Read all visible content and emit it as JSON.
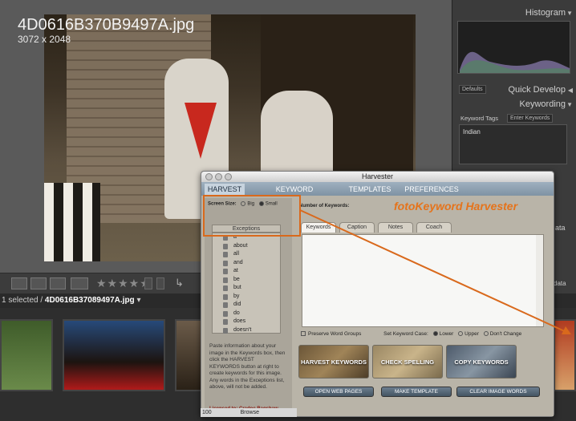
{
  "photo": {
    "filename": "4D0616B370B9497A.jpg",
    "dimensions": "3072 x 2048"
  },
  "toolbar": {
    "stars": "★★★★★"
  },
  "pathbar": {
    "selected_prefix": "1 selected / ",
    "selected_file": "4D0616B37089497A.jpg",
    "caret": "▾"
  },
  "right_panel": {
    "histogram_title": "Histogram",
    "defaults_label": "Defaults",
    "quick_develop_title": "Quick Develop",
    "keywording_title": "Keywording",
    "keyword_tags_label": "Keyword Tags",
    "keyword_tags_select": "Enter Keywords",
    "keyword_value": "Indian",
    "metadata_partial": "ata",
    "metadata_partial2": "data"
  },
  "harvester": {
    "title": "Harvester",
    "tabs": [
      "HARVEST",
      "KEYWORD COMPOSER",
      "TEMPLATES",
      "PREFERENCES"
    ],
    "screen_size_label": "Screen Size:",
    "screen_size_big": "Big",
    "screen_size_small": "Small",
    "number_of_keywords_label": "Number of Keywords:",
    "brand": "fotoKeyword Harvester",
    "exceptions_header": "Exceptions",
    "exceptions": [
      "a",
      "about",
      "all",
      "and",
      "at",
      "be",
      "but",
      "by",
      "did",
      "do",
      "does",
      "doesn't"
    ],
    "paste_info": "Paste information about your image in the Keywords box, then click the HARVEST KEYWORDS button at right to create keywords for this image. Any words in the Exceptions list, above, will not be added.",
    "licensed": "Licensed to: Cradoc Bagshaw",
    "inner_tabs": [
      "Keywords",
      "Caption",
      "Notes",
      "Coach"
    ],
    "preserve_label": "Preserve Word Groups",
    "case_label": "Set Keyword Case:",
    "case_lower": "Lower",
    "case_upper": "Upper",
    "case_dont": "Don't Change",
    "buttons": {
      "harvest": "HARVEST KEYWORDS",
      "spell": "CHECK SPELLING",
      "copy": "COPY KEYWORDS",
      "open_web": "OPEN WEB PAGES",
      "make_template": "MAKE TEMPLATE",
      "clear": "CLEAR IMAGE WORDS"
    },
    "status_zoom": "100",
    "status_browse": "Browse"
  },
  "colors": {
    "accent_orange": "#d9691c",
    "tab_bar": "#8496a6"
  }
}
